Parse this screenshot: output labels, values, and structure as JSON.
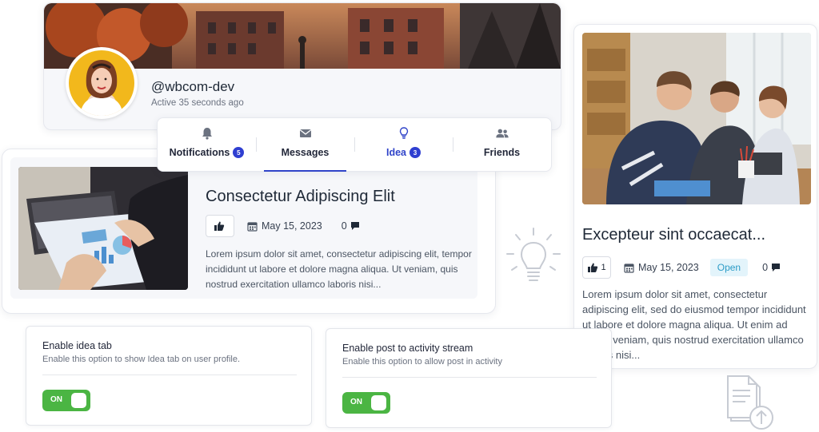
{
  "profile": {
    "username": "@wbcom-dev",
    "active_text": "Active 35 seconds ago"
  },
  "tabs": [
    {
      "label": "Notifications",
      "icon": "bell-icon",
      "badge": "5"
    },
    {
      "label": "Messages",
      "icon": "envelope-icon",
      "badge": ""
    },
    {
      "label": "Idea",
      "icon": "lightbulb-icon",
      "badge": "3"
    },
    {
      "label": "Friends",
      "icon": "users-icon",
      "badge": ""
    }
  ],
  "post": {
    "title": "Consectetur Adipiscing Elit",
    "likes": "",
    "date": "May 15, 2023",
    "comments": "0",
    "excerpt": "Lorem ipsum dolor sit amet, consectetur adipiscing elit, tempor incididunt ut labore et dolore magna aliqua. Ut veniam, quis nostrud exercitation ullamco laboris nisi..."
  },
  "side_post": {
    "title": "Excepteur sint occaecat...",
    "likes": "1",
    "date": "May 15, 2023",
    "status": "Open",
    "comments": "0",
    "excerpt": "Lorem ipsum dolor sit amet, consectetur adipiscing elit, sed do eiusmod tempor incididunt ut labore et dolore magna aliqua. Ut enim ad minim veniam, quis nostrud exercitation ullamco laboris nisi..."
  },
  "settings": {
    "idea_tab": {
      "title": "Enable idea tab",
      "description": "Enable this option to show Idea tab on user profile.",
      "toggle_label": "ON"
    },
    "activity_stream": {
      "title": "Enable post to activity stream",
      "description": "Enable this option to allow post in activity",
      "toggle_label": "ON"
    }
  },
  "colors": {
    "accent": "#3044c9",
    "badge": "#2f3fd1",
    "toggle_on": "#4bb543",
    "open_badge_bg": "#e3f4fb",
    "open_badge_text": "#2d9cc7"
  }
}
